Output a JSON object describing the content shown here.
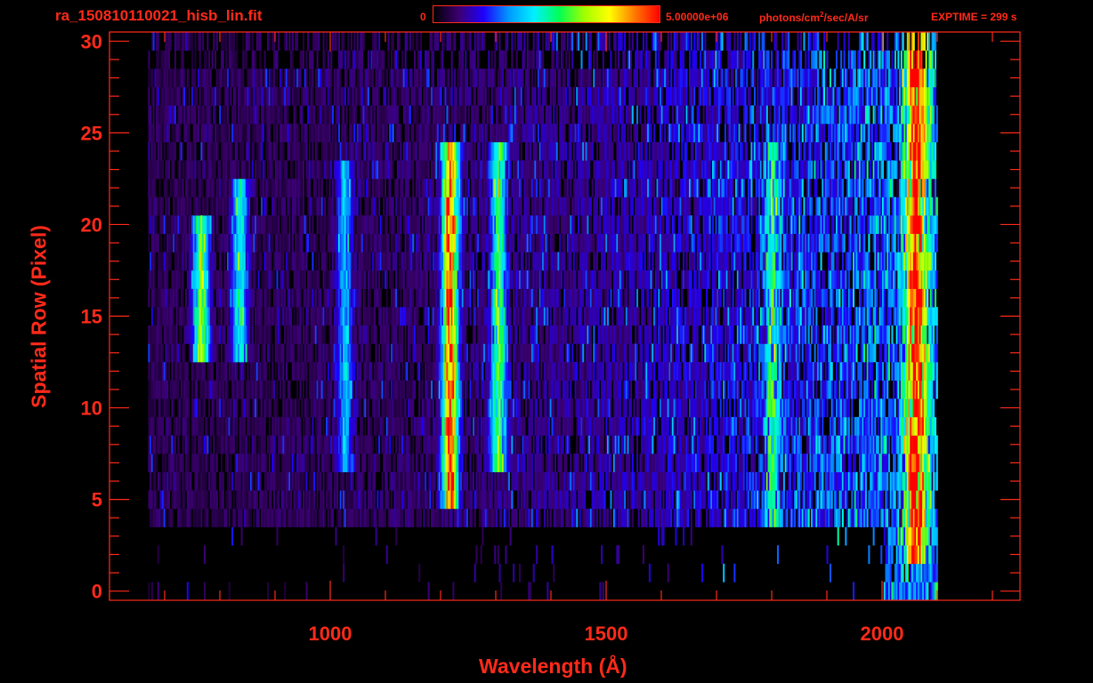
{
  "header": {
    "filename": "ra_150810110021_hisb_lin.fit",
    "colorbar_min_label": "0",
    "colorbar_max_label": "5.00000e+06",
    "colorbar_units_pre": " photons/cm",
    "colorbar_units_sup": "2",
    "colorbar_units_post": "/sec/A/sr",
    "exptime": "EXPTIME = 299 s"
  },
  "colors": {
    "axis": "#ff2a1a",
    "background": "#000000",
    "colormap": [
      "#000000",
      "#3b0070",
      "#1f00ff",
      "#0099ff",
      "#00f0ff",
      "#00ff55",
      "#a0ff00",
      "#ffff00",
      "#ff7a00",
      "#ff0000"
    ]
  },
  "chart_data": {
    "type": "heatmap",
    "title": "ra_150810110021_hisb_lin.fit",
    "xlabel": "Wavelength (Å)",
    "ylabel": "Spatial Row (Pixel)",
    "xlim": [
      600,
      2250
    ],
    "ylim": [
      -0.5,
      30.5
    ],
    "xticks": [
      1000,
      1500,
      2000
    ],
    "yticks": [
      0,
      5,
      10,
      15,
      20,
      25,
      30
    ],
    "x_minor_step": 100,
    "y_minor_step": 1,
    "value_range": [
      0,
      5000000
    ],
    "value_units": "photons/cm^2/sec/A/sr",
    "exptime_s": 299,
    "colormap": "rainbow",
    "data_wavelength_range": [
      670,
      2100
    ],
    "emission_features": [
      {
        "wavelength": 765,
        "rows": [
          13,
          20
        ],
        "level": 0.55
      },
      {
        "wavelength": 835,
        "rows": [
          13,
          22
        ],
        "level": 0.4
      },
      {
        "wavelength": 1025,
        "rows": [
          7,
          23
        ],
        "level": 0.3
      },
      {
        "wavelength": 1216,
        "rows": [
          5,
          24
        ],
        "level": 0.85
      },
      {
        "wavelength": 1304,
        "rows": [
          7,
          24
        ],
        "level": 0.45
      },
      {
        "wavelength": 1800,
        "rows": [
          4,
          24
        ],
        "level": 0.33
      },
      {
        "wavelength": 2060,
        "rows": [
          2,
          30
        ],
        "level": 0.75
      }
    ]
  }
}
